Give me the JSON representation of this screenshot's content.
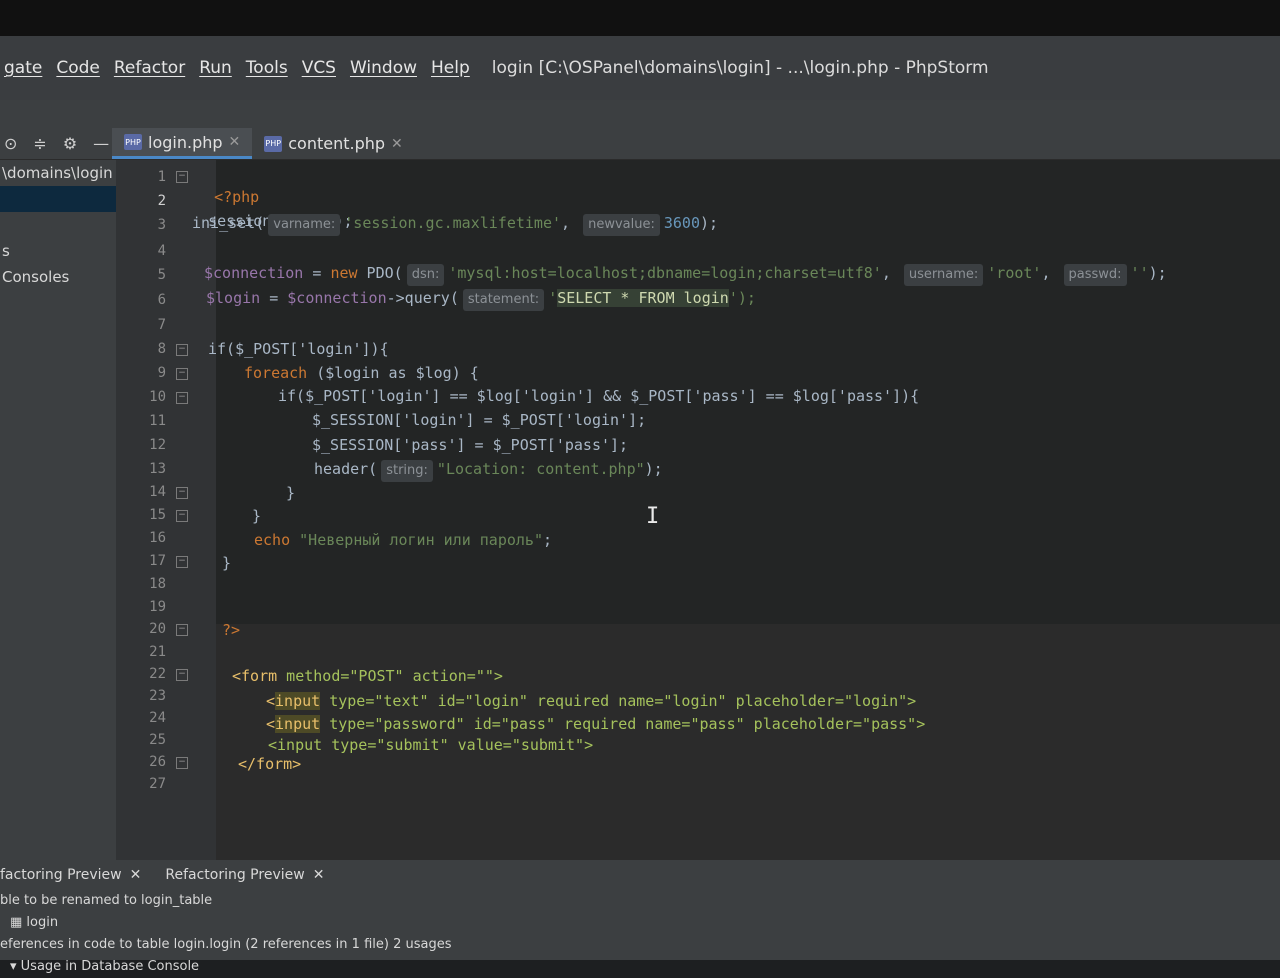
{
  "menu": [
    "gate",
    "Code",
    "Refactor",
    "Run",
    "Tools",
    "VCS",
    "Window",
    "Help"
  ],
  "window_title": "login [C:\\OSPanel\\domains\\login] - ...\\login.php - PhpStorm",
  "tabs": [
    {
      "label": "login.php",
      "active": true
    },
    {
      "label": "content.php",
      "active": false
    }
  ],
  "project": {
    "path": "\\domains\\login",
    "row2": "",
    "row3": "s",
    "consoles": "Consoles"
  },
  "line_numbers": [
    "1",
    "2",
    "3",
    "4",
    "5",
    "6",
    "7",
    "8",
    "9",
    "10",
    "11",
    "12",
    "13",
    "14",
    "15",
    "16",
    "17",
    "18",
    "19",
    "20",
    "21",
    "22",
    "23",
    "24",
    "25",
    "26",
    "27"
  ],
  "code": {
    "l1_open": "<?php",
    "l2": "session_start();",
    "l3_fn": "ini_set(",
    "l3_hint1": "varname:",
    "l3_str": "'session.gc.maxlifetime'",
    "l3_hint2": "newvalue:",
    "l3_num": "3600",
    "l3_end": ");",
    "l5_var": "$connection",
    "l5_eq": " = ",
    "l5_new": "new",
    "l5_cls": " PDO(",
    "l5_hint_dsn": "dsn:",
    "l5_dsn": "'mysql:host=localhost;dbname=login;charset=utf8'",
    "l5_hint_user": "username:",
    "l5_user": "'root'",
    "l5_hint_pass": "passwd:",
    "l5_pass": "''",
    "l5_end": ");",
    "l6_var": "$login",
    "l6_mid": " = ",
    "l6_var2": "$connection",
    "l6_call": "->query(",
    "l6_hint": "statement:",
    "l6_sql_q": "'",
    "l6_sql": "SELECT * FROM login",
    "l6_end": "');",
    "l8": "if($_POST['login']){",
    "l9_kw": "foreach",
    "l9_rest": " ($login as $log) {",
    "l10": "if($_POST['login'] == $log['login'] && $_POST['pass'] == $log['pass']){",
    "l11": "$_SESSION['login'] = $_POST['login'];",
    "l12": "$_SESSION['pass'] = $_POST['pass'];",
    "l13_fn": "header(",
    "l13_hint": "string:",
    "l13_str": "\"Location: content.php\"",
    "l13_end": ");",
    "l14": "}",
    "l15": "}",
    "l16_kw": "echo",
    "l16_str": "\"Неверный логин или пароль\"",
    "l16_end": ";",
    "l17": "}",
    "l20": "?>",
    "l22_tag": "<form",
    "l22_attrs": " method=\"POST\" action=\"\">",
    "l23_lt": "<",
    "l23_tag": "input",
    "l23_rest": " type=\"text\" id=\"login\" required name=\"login\" placeholder=\"login\">",
    "l24_lt": "<",
    "l24_tag": "input",
    "l24_rest": " type=\"password\" id=\"pass\" required name=\"pass\" placeholder=\"pass\">",
    "l25": "<input type=\"submit\" value=\"submit\">",
    "l26": "</form>"
  },
  "bottom": {
    "tab1": "factoring Preview",
    "tab2": "Refactoring Preview",
    "line1": "ble to be renamed to login_table",
    "line2": "login",
    "line3": "eferences in code to table login.login (2 references in 1 file)  2 usages",
    "line4": "Usage in Database Console"
  }
}
